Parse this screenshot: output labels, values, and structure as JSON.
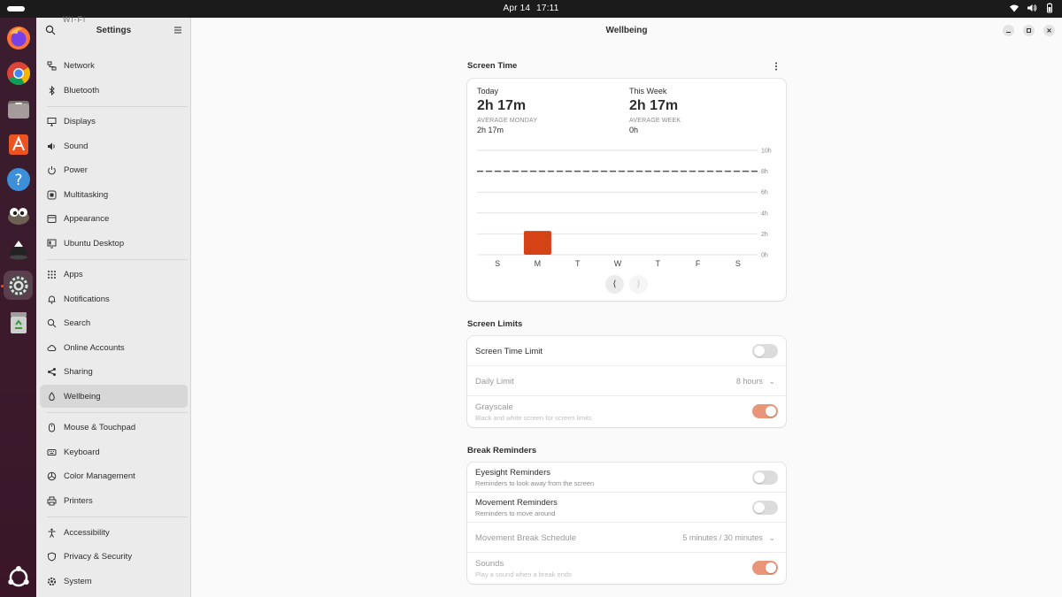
{
  "topbar": {
    "date": "Apr 14",
    "time": "17:11"
  },
  "dock": {
    "items": [
      {
        "icon": "firefox-icon"
      },
      {
        "icon": "chrome-icon"
      },
      {
        "icon": "files-icon"
      },
      {
        "icon": "app-center-icon"
      },
      {
        "icon": "help-icon"
      },
      {
        "icon": "gimp-icon"
      },
      {
        "icon": "inkscape-icon"
      },
      {
        "icon": "settings-icon",
        "active": true
      },
      {
        "icon": "trash-icon"
      },
      {
        "icon": "show-apps-icon"
      }
    ]
  },
  "sidebar": {
    "title": "Settings",
    "cut_item": "Wi-Fi",
    "items": [
      {
        "label": "Network",
        "icon": "network-icon"
      },
      {
        "label": "Bluetooth",
        "icon": "bluetooth-icon"
      },
      {
        "label": "Displays",
        "icon": "display-icon"
      },
      {
        "label": "Sound",
        "icon": "sound-icon"
      },
      {
        "label": "Power",
        "icon": "power-icon"
      },
      {
        "label": "Multitasking",
        "icon": "multitasking-icon"
      },
      {
        "label": "Appearance",
        "icon": "appearance-icon"
      },
      {
        "label": "Ubuntu Desktop",
        "icon": "ubuntu-desktop-icon"
      },
      {
        "label": "Apps",
        "icon": "apps-icon"
      },
      {
        "label": "Notifications",
        "icon": "notifications-icon"
      },
      {
        "label": "Search",
        "icon": "search-icon"
      },
      {
        "label": "Online Accounts",
        "icon": "cloud-icon"
      },
      {
        "label": "Sharing",
        "icon": "sharing-icon"
      },
      {
        "label": "Wellbeing",
        "icon": "wellbeing-icon",
        "selected": true
      },
      {
        "label": "Mouse & Touchpad",
        "icon": "mouse-icon"
      },
      {
        "label": "Keyboard",
        "icon": "keyboard-icon"
      },
      {
        "label": "Color Management",
        "icon": "color-icon"
      },
      {
        "label": "Printers",
        "icon": "printer-icon"
      },
      {
        "label": "Accessibility",
        "icon": "accessibility-icon"
      },
      {
        "label": "Privacy & Security",
        "icon": "privacy-icon"
      },
      {
        "label": "System",
        "icon": "system-icon"
      }
    ]
  },
  "content": {
    "title": "Wellbeing",
    "screen_time": {
      "section_title": "Screen Time",
      "today": {
        "caption": "Today",
        "value": "2h 17m",
        "avg_label": "AVERAGE MONDAY",
        "avg_value": "2h 17m"
      },
      "week": {
        "caption": "This Week",
        "value": "2h 17m",
        "avg_label": "AVERAGE WEEK",
        "avg_value": "0h"
      }
    },
    "screen_limits": {
      "section_title": "Screen Limits",
      "rows": [
        {
          "title": "Screen Time Limit",
          "switch_on": false
        },
        {
          "title": "Daily Limit",
          "value": "8 hours"
        },
        {
          "title": "Grayscale",
          "subtitle": "Black and white screen for screen limits",
          "switch_on": true
        }
      ]
    },
    "break_reminders": {
      "section_title": "Break Reminders",
      "rows": [
        {
          "title": "Eyesight Reminders",
          "subtitle": "Reminders to look away from the screen",
          "switch_on": false
        },
        {
          "title": "Movement Reminders",
          "subtitle": "Reminders to move around",
          "switch_on": false
        },
        {
          "title": "Movement Break Schedule",
          "value": "5 minutes / 30 minutes"
        },
        {
          "title": "Sounds",
          "subtitle": "Play a sound when a break ends",
          "switch_on": true
        }
      ]
    }
  },
  "colors": {
    "accent": "#e95420",
    "bar": "#d44215",
    "switch_on": "#e9957a"
  },
  "chart_data": {
    "type": "bar",
    "categories": [
      "S",
      "M",
      "T",
      "W",
      "T",
      "F",
      "S"
    ],
    "values": [
      0,
      2.28,
      0,
      0,
      0,
      0,
      0
    ],
    "y_ticks": [
      "0h",
      "2h",
      "4h",
      "6h",
      "8h",
      "10h"
    ],
    "ylim": [
      0,
      10
    ],
    "limit_line": 8,
    "grid": true
  }
}
